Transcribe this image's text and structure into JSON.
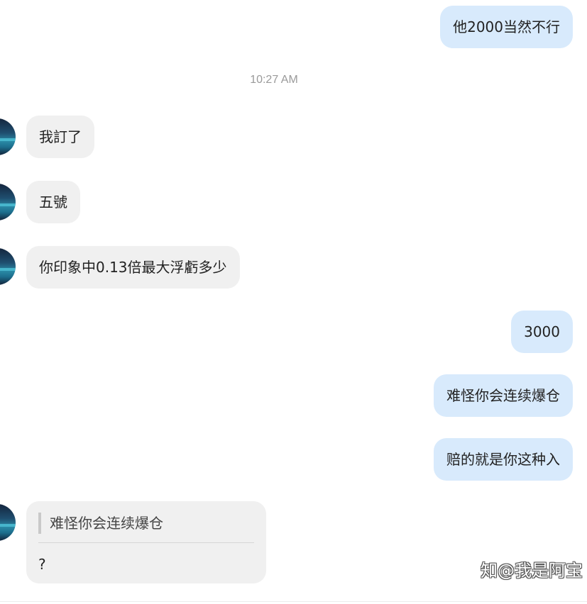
{
  "messages": {
    "m1": "他2000当然不行",
    "timestamp": "10:27 AM",
    "m2": "我訂了",
    "m3": "五號",
    "m4": "你印象中0.13倍最大浮虧多少",
    "m5": "3000",
    "m6": "难怪你会连续爆仓",
    "m7": "赔的就是你这种入",
    "m8_quote": "难怪你会连续爆仓",
    "m8_text": "?"
  },
  "watermark": "知@我是阿宝",
  "colors": {
    "outgoing_bubble": "#d8eafc",
    "incoming_bubble": "#f0f0f0",
    "timestamp": "#9a9a9a"
  }
}
